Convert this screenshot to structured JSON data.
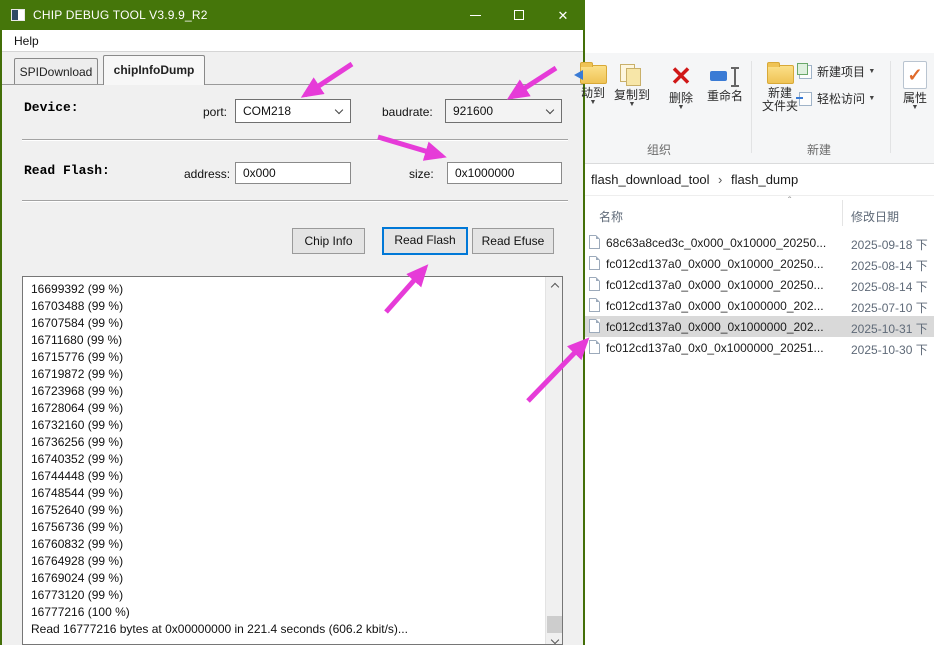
{
  "app": {
    "title": "CHIP DEBUG TOOL V3.9.9_R2",
    "menu": {
      "help": "Help"
    },
    "tabs": {
      "spi": "SPIDownload",
      "chip": "chipInfoDump"
    },
    "device": {
      "label": "Device:",
      "port_label": "port:",
      "port_value": "COM218",
      "baudrate_label": "baudrate:",
      "baudrate_value": "921600"
    },
    "read_flash": {
      "label": "Read Flash:",
      "address_label": "address:",
      "address_value": "0x000",
      "size_label": "size:",
      "size_value": "0x1000000"
    },
    "buttons": {
      "chip_info": "Chip Info",
      "read_flash": "Read Flash",
      "read_efuse": "Read Efuse"
    },
    "log_lines": [
      "16699392 (99 %)",
      "16703488 (99 %)",
      "16707584 (99 %)",
      "16711680 (99 %)",
      "16715776 (99 %)",
      "16719872 (99 %)",
      "16723968 (99 %)",
      "16728064 (99 %)",
      "16732160 (99 %)",
      "16736256 (99 %)",
      "16740352 (99 %)",
      "16744448 (99 %)",
      "16748544 (99 %)",
      "16752640 (99 %)",
      "16756736 (99 %)",
      "16760832 (99 %)",
      "16764928 (99 %)",
      "16769024 (99 %)",
      "16773120 (99 %)",
      "16777216 (100 %)",
      "Read 16777216 bytes at 0x00000000 in 221.4 seconds (606.2 kbit/s)..."
    ]
  },
  "explorer": {
    "ribbon": {
      "move_to": "动到",
      "copy_to": "复制到",
      "delete": "删除",
      "rename": "重命名",
      "new_folder_line1": "新建",
      "new_folder_line2": "文件夹",
      "new_item": "新建项目",
      "easy_access": "轻松访问",
      "properties": "属性",
      "group_organize": "组织",
      "group_new": "新建"
    },
    "breadcrumb": {
      "parent": "flash_download_tool",
      "separator": "›",
      "current": "flash_dump"
    },
    "columns": {
      "name": "名称",
      "date": "修改日期"
    },
    "files": [
      {
        "name": "68c63a8ced3c_0x000_0x10000_20250...",
        "date": "2025-09-18 下",
        "selected": false
      },
      {
        "name": "fc012cd137a0_0x000_0x10000_20250...",
        "date": "2025-08-14 下",
        "selected": false
      },
      {
        "name": "fc012cd137a0_0x000_0x10000_20250...",
        "date": "2025-08-14 下",
        "selected": false
      },
      {
        "name": "fc012cd137a0_0x000_0x1000000_202...",
        "date": "2025-07-10 下",
        "selected": false
      },
      {
        "name": "fc012cd137a0_0x000_0x1000000_202...",
        "date": "2025-10-31 下",
        "selected": true
      },
      {
        "name": "fc012cd137a0_0x0_0x1000000_20251...",
        "date": "2025-10-30 下",
        "selected": false
      }
    ]
  },
  "colors": {
    "titlebar_green": "#45760a",
    "annotation_magenta": "#e63bd8",
    "focus_blue": "#0078d7",
    "selection_gray": "#d9d9d9"
  }
}
